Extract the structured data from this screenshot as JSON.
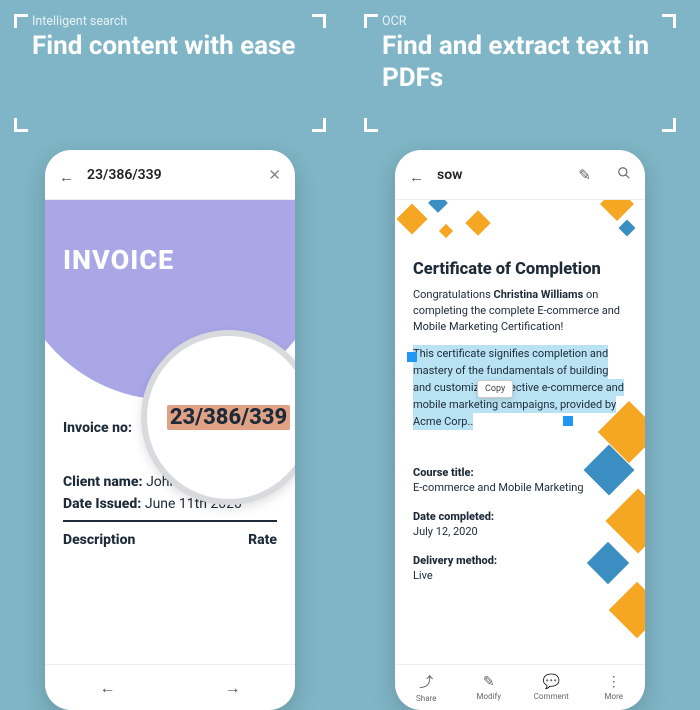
{
  "left": {
    "eyebrow": "Intelligent search",
    "headline": "Find content with ease",
    "phone": {
      "search_value": "23/386/339",
      "invoice_title": "INVOICE",
      "invoice_no_label": "Invoice no:",
      "magnified_value": "23/386/339",
      "client_label": "Client name:",
      "client_value": "John Doe",
      "date_label": "Date Issued:",
      "date_value": "June 11th 2020",
      "col_description": "Description",
      "col_rate": "Rate"
    }
  },
  "right": {
    "eyebrow": "OCR",
    "headline": "Find and extract text in PDFs",
    "phone": {
      "search_value": "sow",
      "cert_title": "Certificate of Completion",
      "congrats_prefix": "Congratulations ",
      "congrats_name": "Christina Williams",
      "congrats_suffix": " on completing the complete E-commerce and Mobile Marketing Certification!",
      "highlighted_text": "This certificate signifies completion and mastery of the fundamentals of building and customizing effective e-commerce and mobile marketing campaigns, provided by Acme Corp..",
      "copy_label": "Copy",
      "fields": {
        "course_label": "Course title:",
        "course_value": "E-commerce and Mobile Marketing",
        "date_label": "Date completed:",
        "date_value": "July 12, 2020",
        "delivery_label": "Delivery method:",
        "delivery_value": "Live"
      },
      "actions": {
        "share": "Share",
        "modify": "Modify",
        "comment": "Comment",
        "more": "More"
      }
    }
  }
}
